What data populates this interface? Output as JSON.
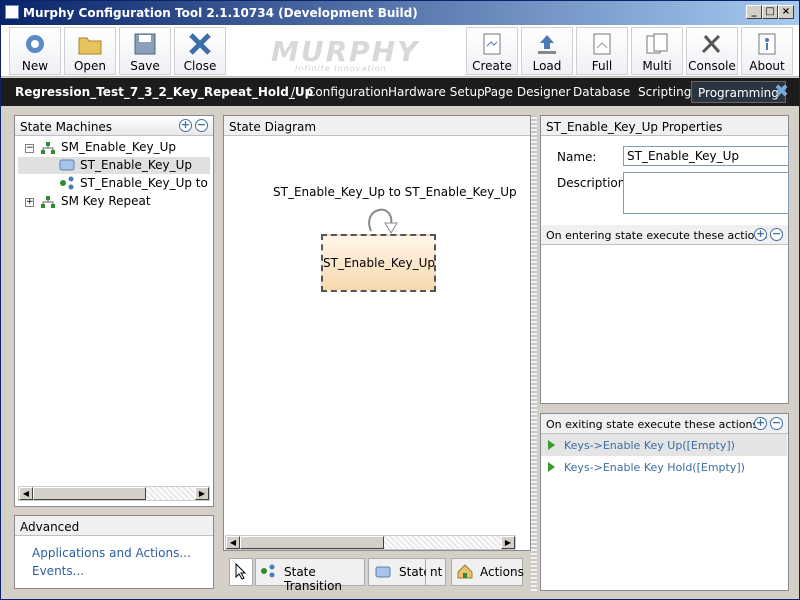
{
  "window": {
    "title": "Murphy Configuration Tool 2.1.10734 (Development Build)"
  },
  "toolbar": {
    "left_buttons": [
      "New",
      "Open",
      "Save",
      "Close"
    ],
    "right_buttons": [
      "Create",
      "Load",
      "Full",
      "Multi",
      "Console",
      "About"
    ],
    "logo_text": "MURPHY",
    "logo_tagline": "Infinite Innovation"
  },
  "navbar": {
    "project": "Regression_Test_7_3_2_Key_Repeat_Hold_Up",
    "separator": "/",
    "tabs": [
      "Configuration",
      "Hardware Setup",
      "Page Designer",
      "Database",
      "Scripting",
      "Programming"
    ],
    "active": "Programming"
  },
  "state_machines": {
    "title": "State Machines",
    "items": [
      {
        "label": "SM_Enable_Key_Up",
        "expanded": true
      },
      {
        "label": "ST_Enable_Key_Up",
        "selected": true
      },
      {
        "label": "ST_Enable_Key_Up to ST_"
      },
      {
        "label": "SM Key Repeat",
        "expanded": false
      }
    ]
  },
  "advanced": {
    "title": "Advanced",
    "links": [
      "Applications and Actions...",
      "Events..."
    ]
  },
  "diagram": {
    "title": "State Diagram",
    "transition_label": "ST_Enable_Key_Up to ST_Enable_Key_Up",
    "state_label": "ST_Enable_Key_Up",
    "tools": [
      "State Transition",
      "State",
      "nt",
      "Actions"
    ]
  },
  "properties": {
    "title": "ST_Enable_Key_Up Properties",
    "name_label": "Name:",
    "name_value": "ST_Enable_Key_Up",
    "description_label": "Description:",
    "description_value": "",
    "entering_title": "On entering state execute these actions",
    "exiting_title": "On exiting state execute these actions",
    "exiting_actions": [
      "Keys->Enable Key Up([Empty])",
      "Keys->Enable Key Hold([Empty])"
    ]
  },
  "colors": {
    "nav_bg": "#1c1c1c",
    "title_bg": "#0a246a",
    "link": "#2b5fa0",
    "state_fill": "#f7d8ad"
  }
}
